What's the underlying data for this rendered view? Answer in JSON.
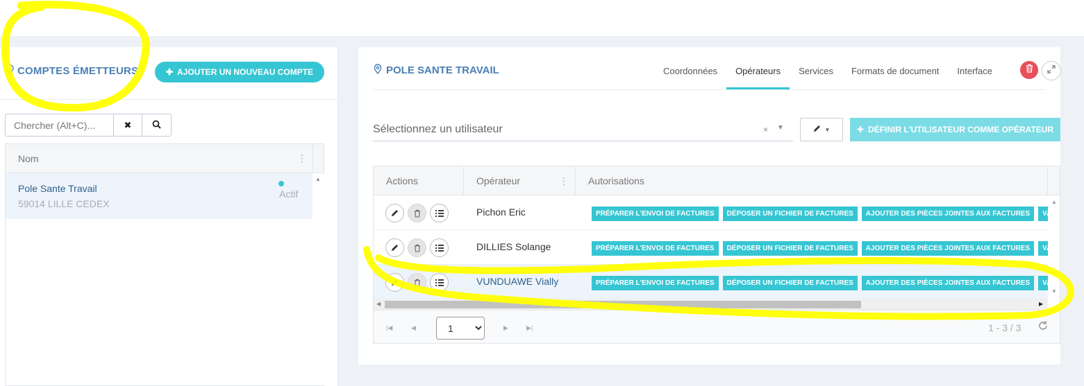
{
  "left": {
    "title": "COMPTES ÉMETTEURS",
    "add_button": "AJOUTER UN NOUVEAU COMPTE",
    "search_placeholder": "Chercher (Alt+C)...",
    "column_name": "Nom",
    "rows": [
      {
        "name": "Pole Sante Travail",
        "city": "59014 LILLE CEDEX",
        "status": "Actif"
      }
    ]
  },
  "right": {
    "title": "POLE SANTE TRAVAIL",
    "tabs": [
      "Coordonnées",
      "Opérateurs",
      "Services",
      "Formats de document",
      "Interface"
    ],
    "active_tab": "Opérateurs",
    "user_select_placeholder": "Sélectionnez un utilisateur",
    "clear_symbol": "×",
    "define_button": "DÉFINIR L'UTILISATEUR COMME OPÉRATEUR",
    "columns": [
      "Actions",
      "Opérateur",
      "Autorisations"
    ],
    "rows": [
      {
        "operator": "Pichon Eric",
        "permissions": [
          "PRÉPARER L'ENVOI DE FACTURES",
          "DÉPOSER UN FICHIER DE FACTURES",
          "AJOUTER DES PIÈCES JOINTES AUX FACTURES",
          "VALIDER LES"
        ]
      },
      {
        "operator": "DILLIES Solange",
        "permissions": [
          "PRÉPARER L'ENVOI DE FACTURES",
          "DÉPOSER UN FICHIER DE FACTURES",
          "AJOUTER DES PIÈCES JOINTES AUX FACTURES",
          "VALIDER LES"
        ]
      },
      {
        "operator": "VUNDUAWE Vially",
        "permissions": [
          "PRÉPARER L'ENVOI DE FACTURES",
          "DÉPOSER UN FICHIER DE FACTURES",
          "AJOUTER DES PIÈCES JOINTES AUX FACTURES",
          "VALIDER LES"
        ]
      }
    ],
    "pager": {
      "page": "1",
      "count": "1 - 3 / 3"
    }
  },
  "colors": {
    "accent": "#36c6d3",
    "title_blue": "#4a7fb5",
    "danger": "#e7505a",
    "highlight": "#ffff00"
  }
}
